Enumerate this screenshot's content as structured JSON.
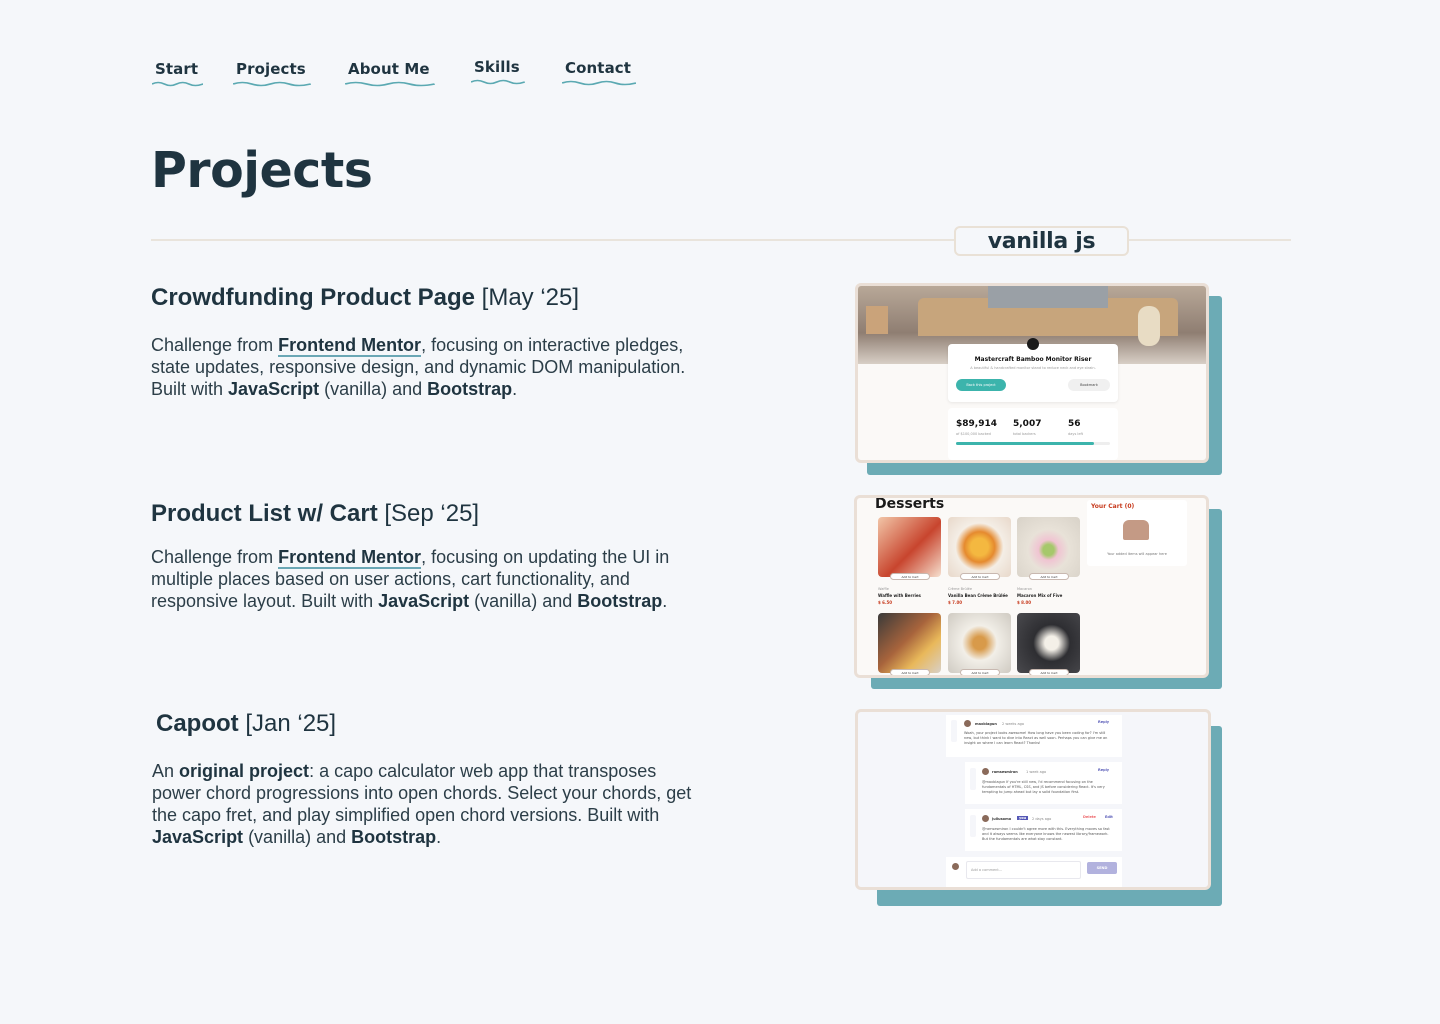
{
  "nav": {
    "items": [
      {
        "label": "Start"
      },
      {
        "label": "Projects"
      },
      {
        "label": "About Me"
      },
      {
        "label": "Skills"
      },
      {
        "label": "Contact"
      }
    ],
    "underline_color": "#5ba9b2"
  },
  "page_title": "Projects",
  "category_tag": "vanilla js",
  "projects": [
    {
      "title": "Crowdfunding Product Page",
      "date": "[May ‘25]",
      "desc_1": "Challenge from ",
      "link": "Frontend Mentor",
      "desc_2": ", focusing on interactive pledges, state updates, responsive design, and dynamic DOM manipulation. Built with ",
      "tech_1": "JavaScript",
      "desc_3": " (vanilla) and ",
      "tech_2": "Bootstrap",
      "desc_4": ".",
      "screenshot": {
        "card_title": "Mastercraft Bamboo Monitor Riser",
        "card_sub": "A beautiful & handcrafted monitor stand to reduce neck and eye strain.",
        "back_button": "Back this project",
        "bookmark_button": "Bookmark",
        "stat_1": "$89,914",
        "stat_1_label": "of $100,000 backed",
        "stat_2": "5,007",
        "stat_2_label": "total backers",
        "stat_3": "56",
        "stat_3_label": "days left",
        "progress": 0.899
      }
    },
    {
      "title": "Product List w/ Cart",
      "date": "[Sep ‘25]",
      "desc_1": "Challenge from ",
      "link": "Frontend Mentor",
      "desc_2": ", focusing on updating the UI in multiple places based on user actions, cart functionality, and responsive layout. Built with ",
      "tech_1": "JavaScript",
      "desc_3": " (vanilla) and ",
      "tech_2": "Bootstrap",
      "desc_4": ".",
      "screenshot": {
        "heading": "Desserts",
        "cart_title": "Your Cart (0)",
        "cart_empty": "Your added items will appear here",
        "add_label": "Add to Cart",
        "items": [
          {
            "category": "Waffle",
            "name": "Waffle with Berries",
            "price": "$ 6.50"
          },
          {
            "category": "Crème Brûlée",
            "name": "Vanilla Bean Crème Brûlée",
            "price": "$ 7.00"
          },
          {
            "category": "Macaron",
            "name": "Macaron Mix of Five",
            "price": "$ 8.00"
          }
        ]
      }
    },
    {
      "title": "Capoot",
      "date": "[Jan ‘25]",
      "desc_1": "An ",
      "highlight": "original project",
      "desc_2": ": a capo calculator web app that transposes power chord progressions into open chords. Select your chords, get the capo fret, and play simplified open chord versions. Built with ",
      "tech_1": "JavaScript",
      "desc_3": " (vanilla) and ",
      "tech_2": "Bootstrap",
      "desc_4": ".",
      "screenshot": {
        "c1_name": "maxblagun",
        "c1_time": "2 weeks ago",
        "c1_text": "Woah, your project looks awesome! How long have you been coding for? I'm still new, but think I want to dive into React as well soon. Perhaps you can give me an insight on where I can learn React? Thanks!",
        "c2_name": "ramsesmiron",
        "c2_time": "1 week ago",
        "c2_text": "@maxblagun If you're still new, I'd recommend focusing on the fundamentals of HTML, CSS, and JS before considering React. It's very tempting to jump ahead but lay a solid foundation first.",
        "c3_name": "juliusomo",
        "c3_badge": "you",
        "c3_time": "2 days ago",
        "c3_text": "@ramsesmiron I couldn't agree more with this. Everything moves so fast and it always seems like everyone knows the newest library/framework. But the fundamentals are what stay constant.",
        "reply": "Reply",
        "delete": "Delete",
        "edit": "Edit",
        "placeholder": "Add a comment...",
        "send": "SEND"
      }
    }
  ],
  "colors": {
    "background": "#f5f7fa",
    "text": "#1f3440",
    "accent_teal": "#6cabb5",
    "frame_border": "#eadfd6"
  }
}
